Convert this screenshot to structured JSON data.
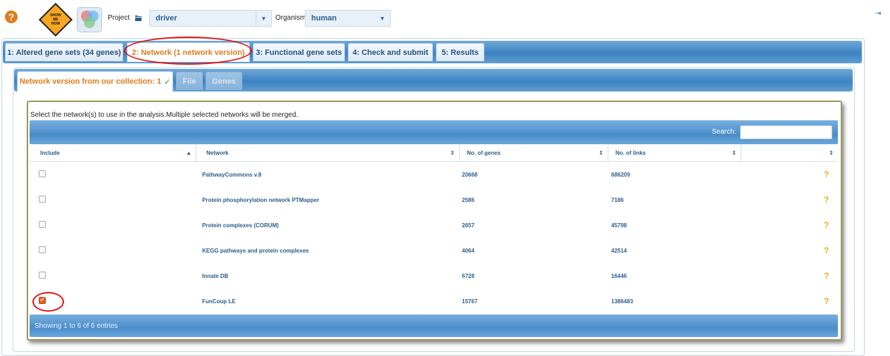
{
  "header": {
    "showme": [
      "SHOW",
      "ME",
      "HOW"
    ],
    "project_label": "Project",
    "project_value": "driver",
    "organism_label": "Organism",
    "organism_value": "human",
    "icons": [
      "help-icon",
      "show-me-how-icon",
      "venn-logo-icon",
      "folder-icon",
      "logout-icon"
    ]
  },
  "outer_tabs": [
    {
      "label": "1: Altered gene sets (34 genes)"
    },
    {
      "label": "2: Network (1 network version)"
    },
    {
      "label": "3: Functional gene sets"
    },
    {
      "label": "4: Check and submit"
    },
    {
      "label": "5: Results"
    }
  ],
  "inner_tabs": [
    {
      "label": "Network version from our collection: 1"
    },
    {
      "label": "File"
    },
    {
      "label": "Genes"
    }
  ],
  "instruction": "Select the network(s) to use in the analysis.Multiple selected networks will be merged.",
  "search_label": "Search:",
  "columns": [
    "Include",
    "Network",
    "No. of genes",
    "No. of links",
    ""
  ],
  "rows": [
    {
      "network": "PathwayCommons v.8",
      "genes": "20668",
      "links": "686209",
      "checked": false
    },
    {
      "network": "Protein phosphorylation network PTMapper",
      "genes": "2586",
      "links": "7186",
      "checked": false
    },
    {
      "network": "Protein complexes (CORUM)",
      "genes": "2657",
      "links": "45798",
      "checked": false
    },
    {
      "network": "KEGG pathways and protein complexes",
      "genes": "4064",
      "links": "42514",
      "checked": false
    },
    {
      "network": "Innate DB",
      "genes": "6728",
      "links": "16446",
      "checked": false
    },
    {
      "network": "FunCoup LE",
      "genes": "15767",
      "links": "1386483",
      "checked": true
    }
  ],
  "footer": "Showing 1 to 6 of 6 entries",
  "colors": {
    "accent": "#e07b1b",
    "link": "#2c5e8e",
    "header_blue": "#4a8ccb",
    "annotation_red": "#e01515"
  }
}
